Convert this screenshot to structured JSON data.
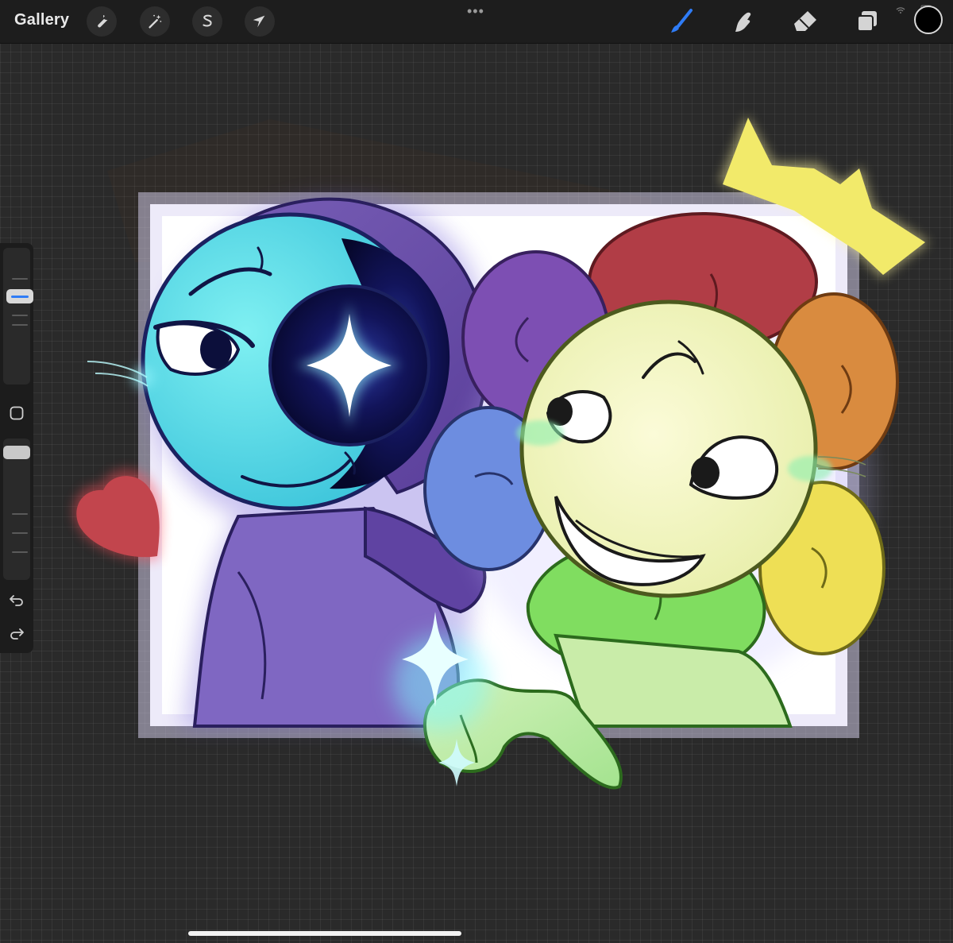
{
  "app": {
    "gallery_label": "Gallery",
    "more_menu": "•••"
  },
  "toolbar": {
    "left_tools": [
      {
        "name": "actions",
        "icon": "wrench-icon"
      },
      {
        "name": "adjustments",
        "icon": "magic-wand-icon"
      },
      {
        "name": "selection",
        "icon": "selection-s-icon"
      },
      {
        "name": "transform",
        "icon": "arrow-cursor-icon"
      }
    ],
    "right_tools": [
      {
        "name": "brush",
        "icon": "brush-icon",
        "active": true
      },
      {
        "name": "smudge",
        "icon": "smudge-finger-icon",
        "active": false
      },
      {
        "name": "eraser",
        "icon": "eraser-icon",
        "active": false
      },
      {
        "name": "layers",
        "icon": "layers-icon",
        "active": false
      }
    ],
    "current_color": "#000000",
    "accent_color": "#2f7cf6"
  },
  "sidebar": {
    "brush_size_icon": "size-slider-icon",
    "modify_icon": "square-modify-icon",
    "opacity_icon": "opacity-slider-icon",
    "undo_icon": "undo-arrow-icon",
    "redo_icon": "redo-arrow-icon"
  },
  "canvas": {
    "background_color": "#2a2a2a",
    "paper_color": "#ffffff",
    "characters": [
      {
        "name": "blue-moon-character",
        "colors": [
          "#4fd6e4",
          "#6a4aa8",
          "#0e0f45"
        ]
      },
      {
        "name": "rainbow-flower-character",
        "colors": [
          "#f2f3b8",
          "#b0373e",
          "#d98a3c",
          "#e8d549",
          "#7bdc5e",
          "#6a89d8",
          "#7a4ba7"
        ]
      }
    ],
    "decorations": [
      {
        "name": "heart",
        "color": "#c2454d"
      },
      {
        "name": "crown",
        "color": "#f2ea6a"
      },
      {
        "name": "sparkle",
        "color": "#d6ffff"
      }
    ]
  }
}
